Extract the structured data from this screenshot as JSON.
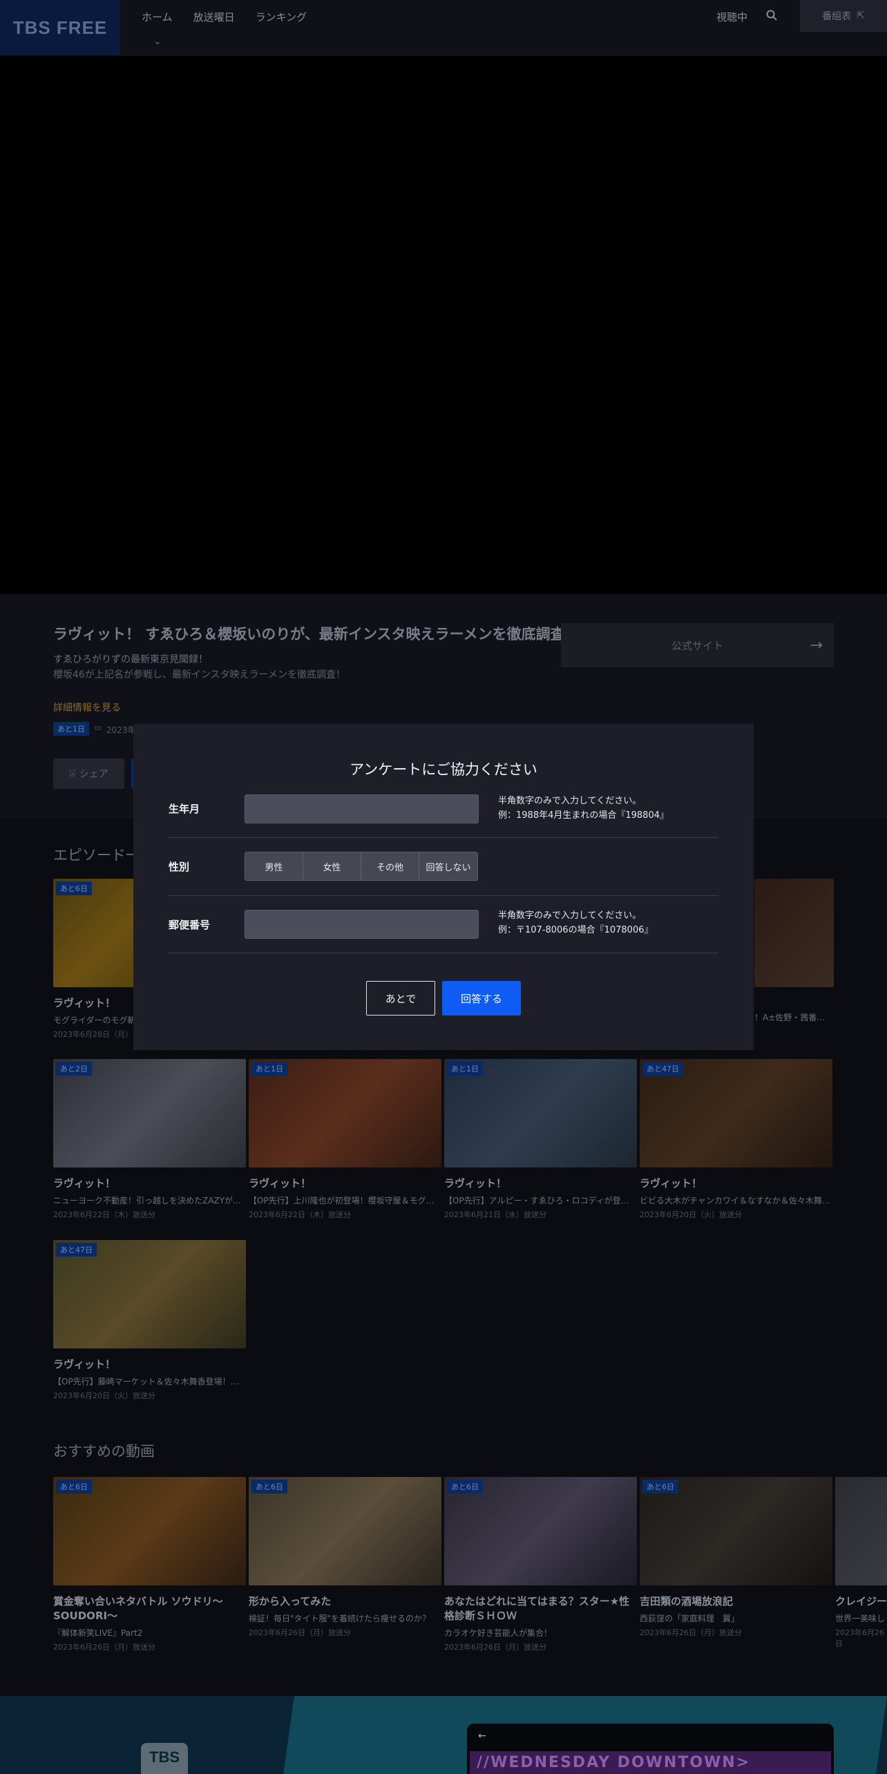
{
  "header": {
    "logo": "TBS FREE",
    "nav": [
      "ホーム",
      "放送曜日",
      "ランキング"
    ],
    "watching": "視聴中",
    "header_button": "番組表"
  },
  "program": {
    "title": "ラヴィット！ すゑひろ＆櫻坂いのりが、最新インスタ映えラーメンを徹底調査！",
    "subtitle1": "すゑひろがりずの最新東京見聞録！",
    "subtitle2": "櫻坂46が上記名が参戦し、最新インスタ映えラーメンを徹底調査！",
    "detail_link": "詳細情報を見る",
    "badge": "あと1日",
    "date": "2023年",
    "share": "シェア",
    "official_site": "公式サイト"
  },
  "episodes": {
    "title": "エピソード一",
    "items": [
      {
        "badge": "あと6日",
        "title": "ラヴィット！",
        "desc": "モグライダーのモグ斬",
        "date": "2023年6月28日（月）"
      },
      {
        "badge": "",
        "title": "",
        "desc": "！A±佐野・茜番…",
        "date": ""
      },
      {
        "badge": "あと2日",
        "title": "ラヴィット！",
        "desc": "ニューヨーク不動産！引っ越しを決めたZAZYが…",
        "date": "2023年6月22日（木）放送分"
      },
      {
        "badge": "あと1日",
        "title": "ラヴィット！",
        "desc": "【OP先行】上川隆也が初登場！櫻坂守屋＆モグ…",
        "date": "2023年6月22日（木）放送分"
      },
      {
        "badge": "あと1日",
        "title": "ラヴィット！",
        "desc": "【OP先行】アルピー・すゑひろ・ロコディが登…",
        "date": "2023年6月21日（水）放送分"
      },
      {
        "badge": "あと47日",
        "title": "ラヴィット！",
        "desc": "ビビる大木がチャンカワイ＆なすなか＆佐々木舞…",
        "date": "2023年6月20日（火）放送分"
      },
      {
        "badge": "あと47日",
        "title": "ラヴィット！",
        "desc": "【OP先行】藤崎マーケット＆佐々木舞香登場！…",
        "date": "2023年6月20日（火）放送分"
      }
    ]
  },
  "recommended": {
    "title": "おすすめの動画",
    "items": [
      {
        "badge": "あと6日",
        "title": "賞金奪い合いネタバトル ソウドリ〜SOUDORI〜",
        "desc": "『解体新笑LIVE』Part2",
        "date": "2023年6月26日（月）放送分"
      },
      {
        "badge": "あと6日",
        "title": "形から入ってみた",
        "desc": "検証！毎日\"タイト服\"を着続けたら痩せるのか？",
        "date": "2023年6月26日（月）放送分"
      },
      {
        "badge": "あと6日",
        "title": "あなたはどれに当てはまる？スター★性格診断ＳＨＯＷ",
        "desc": "カラオケ好き芸能人が集合！",
        "date": "2023年6月26日（月）放送分"
      },
      {
        "badge": "あと6日",
        "title": "吉田類の酒場放浪記",
        "desc": "西荻窪の「家庭料理　翼」",
        "date": "2023年6月26日（月）放送分"
      },
      {
        "badge": "",
        "title": "クレイジー",
        "desc": "世界一美味し",
        "date": "2023年6月26日"
      }
    ]
  },
  "footer": {
    "logo": "TBS",
    "screen_text": "//WEDNESDAY DOWNTOWN>"
  },
  "survey": {
    "title": "アンケートにご協力ください",
    "birth_label": "生年月",
    "birth_value": "",
    "birth_help1": "半角数字のみで入力してください。",
    "birth_help2": "例：1988年4月生まれの場合『198804』",
    "gender_label": "性別",
    "gender_options": [
      "男性",
      "女性",
      "その他",
      "回答しない"
    ],
    "zip_label": "郵便番号",
    "zip_value": "",
    "zip_help1": "半角数字のみで入力してください。",
    "zip_help2": "例：〒107-8006の場合『1078006』",
    "later_button": "あとで",
    "answer_button": "回答する"
  }
}
